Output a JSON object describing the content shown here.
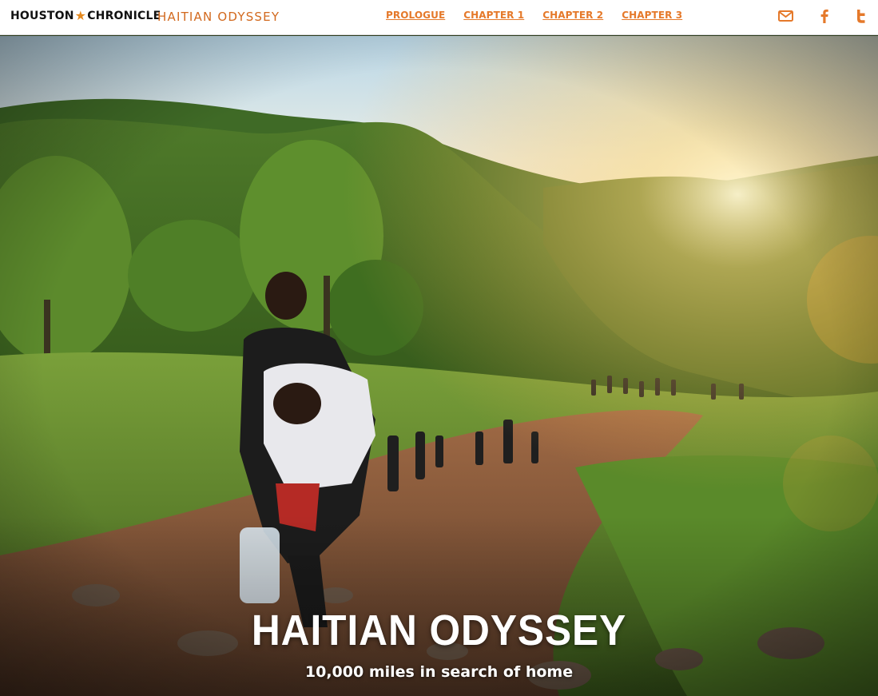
{
  "header": {
    "logo_left": "HOUSTON",
    "logo_right": "CHRONICLE",
    "section_title": "HAITIAN ODYSSEY",
    "nav": [
      {
        "label": "PROLOGUE"
      },
      {
        "label": "CHAPTER 1"
      },
      {
        "label": "CHAPTER 2"
      },
      {
        "label": "CHAPTER 3"
      }
    ],
    "share_icons": [
      "email-icon",
      "facebook-icon",
      "twitter-icon"
    ]
  },
  "hero": {
    "title": "HAITIAN ODYSSEY",
    "subtitle": "10,000 miles in search of home"
  },
  "colors": {
    "accent": "#e5792a",
    "section_title": "#d2691e",
    "header_bg": "#ffffff"
  }
}
